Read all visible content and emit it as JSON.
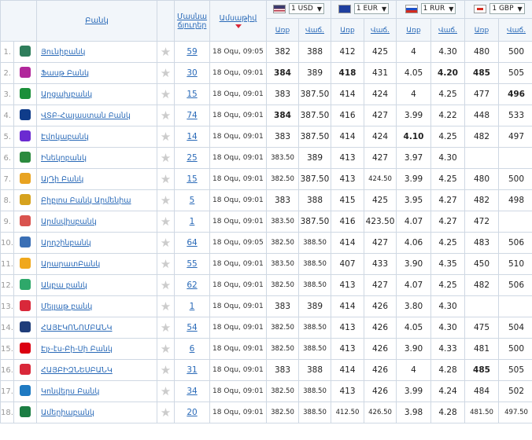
{
  "header": {
    "bank": "Բանկ",
    "branches_1": "Մասնա",
    "branches_2": "ճյուղեր",
    "date": "Ամսաթիվ",
    "buy": "Առք",
    "sell": "Վաճ."
  },
  "currencies": [
    {
      "label": "1 USD",
      "flag": "us-flag-icon"
    },
    {
      "label": "1 EUR",
      "flag": "eu-flag-icon"
    },
    {
      "label": "1 RUR",
      "flag": "ru-flag-icon"
    },
    {
      "label": "1 GBP",
      "flag": "gb-flag-icon"
    }
  ],
  "banks": [
    {
      "num": "1.",
      "name": "Յունիբանկ",
      "logo": "unibank-logo-icon",
      "color": "#2e7d5b",
      "branches": "59",
      "date": "18 Օգս, 09:05",
      "usd": [
        "382",
        "388"
      ],
      "eur": [
        "412",
        "425"
      ],
      "rur": [
        "4",
        "4.30"
      ],
      "gbp": [
        "480",
        "500"
      ]
    },
    {
      "num": "2.",
      "name": "Ֆասթ Բանկ",
      "logo": "fast-bank-logo-icon",
      "color": "#b1279b",
      "branches": "30",
      "date": "18 Օգս, 09:01",
      "usd": [
        "384",
        "389"
      ],
      "eur": [
        "418",
        "431"
      ],
      "rur": [
        "4.05",
        "4.20"
      ],
      "gbp": [
        "485",
        "505"
      ],
      "bold": [
        "usd0",
        "eur0",
        "rur1",
        "gbp0"
      ]
    },
    {
      "num": "3.",
      "name": "Արցախբանկ",
      "logo": "artsakhbank-logo-icon",
      "color": "#1b8f3a",
      "branches": "15",
      "date": "18 Օգս, 09:01",
      "usd": [
        "383",
        "387.50"
      ],
      "eur": [
        "414",
        "424"
      ],
      "rur": [
        "4",
        "4.25"
      ],
      "gbp": [
        "477",
        "496"
      ],
      "bold": [
        "gbp1"
      ]
    },
    {
      "num": "4.",
      "name": "ՎՏԲ-Հայաստան Բանկ",
      "logo": "vtb-logo-icon",
      "color": "#0f3c8a",
      "branches": "74",
      "date": "18 Օգս, 09:01",
      "usd": [
        "384",
        "387.50"
      ],
      "eur": [
        "416",
        "427"
      ],
      "rur": [
        "3.99",
        "4.22"
      ],
      "gbp": [
        "448",
        "533"
      ],
      "bold": [
        "usd0"
      ]
    },
    {
      "num": "5.",
      "name": "Էվոկաբանկ",
      "logo": "evocabank-logo-icon",
      "color": "#6b2bd1",
      "branches": "14",
      "date": "18 Օգս, 09:01",
      "usd": [
        "383",
        "387.50"
      ],
      "eur": [
        "414",
        "424"
      ],
      "rur": [
        "4.10",
        "4.25"
      ],
      "gbp": [
        "482",
        "497"
      ],
      "bold": [
        "rur0"
      ]
    },
    {
      "num": "6.",
      "name": "Ինեկոբանկ",
      "logo": "inecobank-logo-icon",
      "color": "#2b8a3e",
      "branches": "25",
      "date": "18 Օգս, 09:01",
      "usd": [
        "383.50",
        "389"
      ],
      "eur": [
        "413",
        "427"
      ],
      "rur": [
        "3.97",
        "4.30"
      ],
      "gbp": [
        "",
        ""
      ],
      "small": [
        "usd0"
      ]
    },
    {
      "num": "7.",
      "name": "ԱյԴի Բանկ",
      "logo": "idbank-logo-icon",
      "color": "#e8a321",
      "branches": "15",
      "date": "18 Օգս, 09:01",
      "usd": [
        "382.50",
        "387.50"
      ],
      "eur": [
        "413",
        "424.50"
      ],
      "rur": [
        "3.99",
        "4.25"
      ],
      "gbp": [
        "480",
        "500"
      ],
      "small": [
        "usd0",
        "eur1"
      ]
    },
    {
      "num": "8.",
      "name": "Բիբլոս Բանկ Արմենիա",
      "logo": "byblos-logo-icon",
      "color": "#d6a21e",
      "branches": "5",
      "date": "18 Օգս, 09:01",
      "usd": [
        "383",
        "388"
      ],
      "eur": [
        "415",
        "425"
      ],
      "rur": [
        "3.95",
        "4.27"
      ],
      "gbp": [
        "482",
        "498"
      ]
    },
    {
      "num": "9.",
      "name": "Արմսվիսբանկ",
      "logo": "armswissbank-logo-icon",
      "color": "#d9534f",
      "branches": "1",
      "date": "18 Օգս, 09:01",
      "usd": [
        "383.50",
        "387.50"
      ],
      "eur": [
        "416",
        "423.50"
      ],
      "rur": [
        "4.07",
        "4.27"
      ],
      "gbp": [
        "472",
        ""
      ],
      "small": [
        "usd0"
      ]
    },
    {
      "num": "10.",
      "name": "Արդշինբանկ",
      "logo": "ardshinbank-logo-icon",
      "color": "#3a6fb5",
      "branches": "64",
      "date": "18 Օգս, 09:05",
      "usd": [
        "382.50",
        "388.50"
      ],
      "eur": [
        "414",
        "427"
      ],
      "rur": [
        "4.06",
        "4.25"
      ],
      "gbp": [
        "483",
        "506"
      ],
      "small": [
        "usd0",
        "usd1"
      ]
    },
    {
      "num": "11.",
      "name": "ԱրարատԲանկ",
      "logo": "araratbank-logo-icon",
      "color": "#f0a81c",
      "branches": "55",
      "date": "18 Օգս, 09:01",
      "usd": [
        "383.50",
        "388.50"
      ],
      "eur": [
        "407",
        "433"
      ],
      "rur": [
        "3.90",
        "4.35"
      ],
      "gbp": [
        "450",
        "510"
      ],
      "small": [
        "usd0",
        "usd1"
      ]
    },
    {
      "num": "12.",
      "name": "Ակբա բանկ",
      "logo": "acba-logo-icon",
      "color": "#2ea86a",
      "branches": "62",
      "date": "18 Օգս, 09:01",
      "usd": [
        "382.50",
        "388.50"
      ],
      "eur": [
        "413",
        "427"
      ],
      "rur": [
        "4.07",
        "4.25"
      ],
      "gbp": [
        "482",
        "506"
      ],
      "small": [
        "usd0",
        "usd1"
      ]
    },
    {
      "num": "13.",
      "name": "Մելլաթ բանկ",
      "logo": "mellat-logo-icon",
      "color": "#d9283a",
      "branches": "1",
      "date": "18 Օգս, 09:01",
      "usd": [
        "383",
        "389"
      ],
      "eur": [
        "414",
        "426"
      ],
      "rur": [
        "3.80",
        "4.30"
      ],
      "gbp": [
        "",
        ""
      ]
    },
    {
      "num": "14.",
      "name": "ՀԱՅԷԿՈՆՈՄԲԱՆԿ",
      "logo": "aeb-logo-icon",
      "color": "#1f3d7a",
      "branches": "54",
      "date": "18 Օգս, 09:01",
      "usd": [
        "382.50",
        "388.50"
      ],
      "eur": [
        "413",
        "426"
      ],
      "rur": [
        "4.05",
        "4.30"
      ],
      "gbp": [
        "475",
        "504"
      ],
      "small": [
        "usd0",
        "usd1"
      ]
    },
    {
      "num": "15.",
      "name": "Էյչ-էս-Բի-Սի Բանկ",
      "logo": "hsbc-logo-icon",
      "color": "#db0011",
      "branches": "6",
      "date": "18 Օգս, 09:01",
      "usd": [
        "382.50",
        "388.50"
      ],
      "eur": [
        "413",
        "426"
      ],
      "rur": [
        "3.90",
        "4.33"
      ],
      "gbp": [
        "481",
        "500"
      ],
      "small": [
        "usd0",
        "usd1"
      ]
    },
    {
      "num": "16.",
      "name": "ՀԱՅԲԻԶՆԵՍԲԱՆԿ",
      "logo": "armbusinessbank-logo-icon",
      "color": "#d9283a",
      "branches": "31",
      "date": "18 Օգս, 09:01",
      "usd": [
        "383",
        "388"
      ],
      "eur": [
        "414",
        "426"
      ],
      "rur": [
        "4",
        "4.28"
      ],
      "gbp": [
        "485",
        "505"
      ],
      "bold": [
        "gbp0"
      ]
    },
    {
      "num": "17.",
      "name": "Կոնվերս Բանկ",
      "logo": "converse-logo-icon",
      "color": "#1f7ac2",
      "branches": "34",
      "date": "18 Օգս, 09:01",
      "usd": [
        "382.50",
        "388.50"
      ],
      "eur": [
        "413",
        "426"
      ],
      "rur": [
        "3.99",
        "4.24"
      ],
      "gbp": [
        "484",
        "502"
      ],
      "small": [
        "usd0",
        "usd1"
      ]
    },
    {
      "num": "18.",
      "name": "Ամերիաբանկ",
      "logo": "ameriabank-logo-icon",
      "color": "#1b7d43",
      "branches": "20",
      "date": "18 Օգս, 09:01",
      "usd": [
        "382.50",
        "388.50"
      ],
      "eur": [
        "412.50",
        "426.50"
      ],
      "rur": [
        "3.98",
        "4.28"
      ],
      "gbp": [
        "481.50",
        "497.50"
      ],
      "small": [
        "usd0",
        "usd1",
        "eur0",
        "eur1",
        "gbp0",
        "gbp1"
      ]
    }
  ]
}
